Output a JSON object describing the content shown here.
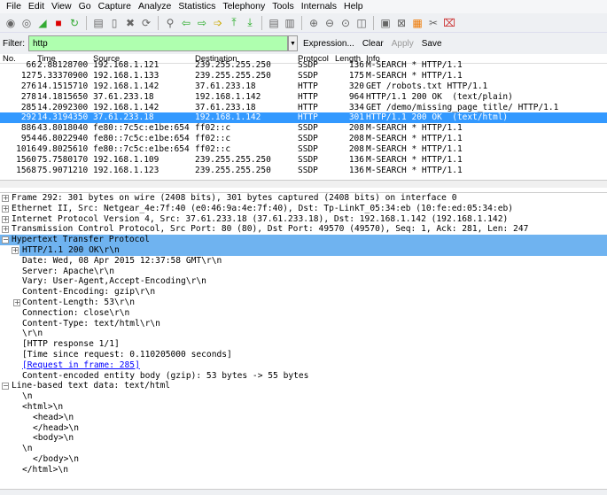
{
  "menu": [
    "File",
    "Edit",
    "View",
    "Go",
    "Capture",
    "Analyze",
    "Statistics",
    "Telephony",
    "Tools",
    "Internals",
    "Help"
  ],
  "toolbar_icons": [
    "interface-list-icon",
    "capture-options-icon",
    "start-capture-icon",
    "stop-capture-icon",
    "restart-capture-icon",
    "open-file-icon",
    "save-file-icon",
    "close-file-icon",
    "reload-icon",
    "find-packet-icon",
    "go-back-icon",
    "go-forward-icon",
    "go-to-packet-icon",
    "first-packet-icon",
    "last-packet-icon",
    "colorize-icon",
    "autoscroll-icon",
    "zoom-in-icon",
    "zoom-out-icon",
    "zoom-normal-icon",
    "resize-columns-icon",
    "capture-filters-icon",
    "display-filters-icon",
    "coloring-rules-icon",
    "preferences-icon",
    "help-icon"
  ],
  "filter": {
    "label": "Filter:",
    "value": "http",
    "expression": "Expression...",
    "clear": "Clear",
    "apply": "Apply",
    "save": "Save",
    "color": "#afffaf"
  },
  "columns": [
    "No.",
    "Time",
    "Source",
    "Destination",
    "Protocol",
    "Length",
    "Info"
  ],
  "packets": [
    [
      "66",
      "2.88128700",
      "192.168.1.121",
      "239.255.255.250",
      "SSDP",
      "136",
      "M-SEARCH * HTTP/1.1"
    ],
    [
      "127",
      "5.33370900",
      "192.168.1.133",
      "239.255.255.250",
      "SSDP",
      "175",
      "M-SEARCH * HTTP/1.1"
    ],
    [
      "276",
      "14.1515710",
      "192.168.1.142",
      "37.61.233.18",
      "HTTP",
      "320",
      "GET /robots.txt HTTP/1.1"
    ],
    [
      "278",
      "14.1815650",
      "37.61.233.18",
      "192.168.1.142",
      "HTTP",
      "964",
      "HTTP/1.1 200 OK  (text/plain)"
    ],
    [
      "285",
      "14.2092300",
      "192.168.1.142",
      "37.61.233.18",
      "HTTP",
      "334",
      "GET /demo/missing_page_title/ HTTP/1.1"
    ],
    [
      "292",
      "14.3194350",
      "37.61.233.18",
      "192.168.1.142",
      "HTTP",
      "301",
      "HTTP/1.1 200 OK  (text/html)"
    ],
    [
      "886",
      "43.8018040",
      "fe80::7c5c:e1be:654",
      "ff02::c",
      "SSDP",
      "208",
      "M-SEARCH * HTTP/1.1"
    ],
    [
      "954",
      "46.8022940",
      "fe80::7c5c:e1be:654",
      "ff02::c",
      "SSDP",
      "208",
      "M-SEARCH * HTTP/1.1"
    ],
    [
      "1016",
      "49.8025610",
      "fe80::7c5c:e1be:654",
      "ff02::c",
      "SSDP",
      "208",
      "M-SEARCH * HTTP/1.1"
    ],
    [
      "1560",
      "75.7580170",
      "192.168.1.109",
      "239.255.255.250",
      "SSDP",
      "136",
      "M-SEARCH * HTTP/1.1"
    ],
    [
      "1568",
      "75.9071210",
      "192.168.1.123",
      "239.255.255.250",
      "SSDP",
      "136",
      "M-SEARCH * HTTP/1.1"
    ]
  ],
  "selected_packet": "292",
  "selection_color": "#3399ff",
  "details": [
    {
      "text": "Frame 292: 301 bytes on wire (2408 bits), 301 bytes captured (2408 bits) on interface 0",
      "indent": 0,
      "toggle": "+"
    },
    {
      "text": "Ethernet II, Src: Netgear_4e:7f:40 (e0:46:9a:4e:7f:40), Dst: Tp-LinkT_05:34:eb (10:fe:ed:05:34:eb)",
      "indent": 0,
      "toggle": "+"
    },
    {
      "text": "Internet Protocol Version 4, Src: 37.61.233.18 (37.61.233.18), Dst: 192.168.1.142 (192.168.1.142)",
      "indent": 0,
      "toggle": "+"
    },
    {
      "text": "Transmission Control Protocol, Src Port: 80 (80), Dst Port: 49570 (49570), Seq: 1, Ack: 281, Len: 247",
      "indent": 0,
      "toggle": "+"
    },
    {
      "text": "Hypertext Transfer Protocol",
      "indent": 0,
      "toggle": "-",
      "hl": true
    },
    {
      "text": "HTTP/1.1 200 OK\\r\\n",
      "indent": 1,
      "toggle": "+",
      "hl": true
    },
    {
      "text": "Date: Wed, 08 Apr 2015 12:37:58 GMT\\r\\n",
      "indent": 1
    },
    {
      "text": "Server: Apache\\r\\n",
      "indent": 1
    },
    {
      "text": "Vary: User-Agent,Accept-Encoding\\r\\n",
      "indent": 1
    },
    {
      "text": "Content-Encoding: gzip\\r\\n",
      "indent": 1
    },
    {
      "text": "Content-Length: 53\\r\\n",
      "indent": 1,
      "toggle": "+"
    },
    {
      "text": "Connection: close\\r\\n",
      "indent": 1
    },
    {
      "text": "Content-Type: text/html\\r\\n",
      "indent": 1
    },
    {
      "text": "\\r\\n",
      "indent": 1
    },
    {
      "text": "[HTTP response 1/1]",
      "indent": 1
    },
    {
      "text": "[Time since request: 0.110205000 seconds]",
      "indent": 1
    },
    {
      "text": "[Request in frame: 285]",
      "indent": 1,
      "link": true
    },
    {
      "text": "Content-encoded entity body (gzip): 53 bytes -> 55 bytes",
      "indent": 1
    },
    {
      "text": "Line-based text data: text/html",
      "indent": 0,
      "toggle": "-"
    },
    {
      "text": "\\n",
      "indent": 1
    },
    {
      "text": "<html>\\n",
      "indent": 1
    },
    {
      "text": "<head>\\n",
      "indent": 2
    },
    {
      "text": "</head>\\n",
      "indent": 2
    },
    {
      "text": "<body>\\n",
      "indent": 2
    },
    {
      "text": "\\n",
      "indent": 1
    },
    {
      "text": "</body>\\n",
      "indent": 2
    },
    {
      "text": "</html>\\n",
      "indent": 1
    }
  ],
  "highlight_color": "#6fb3f0"
}
